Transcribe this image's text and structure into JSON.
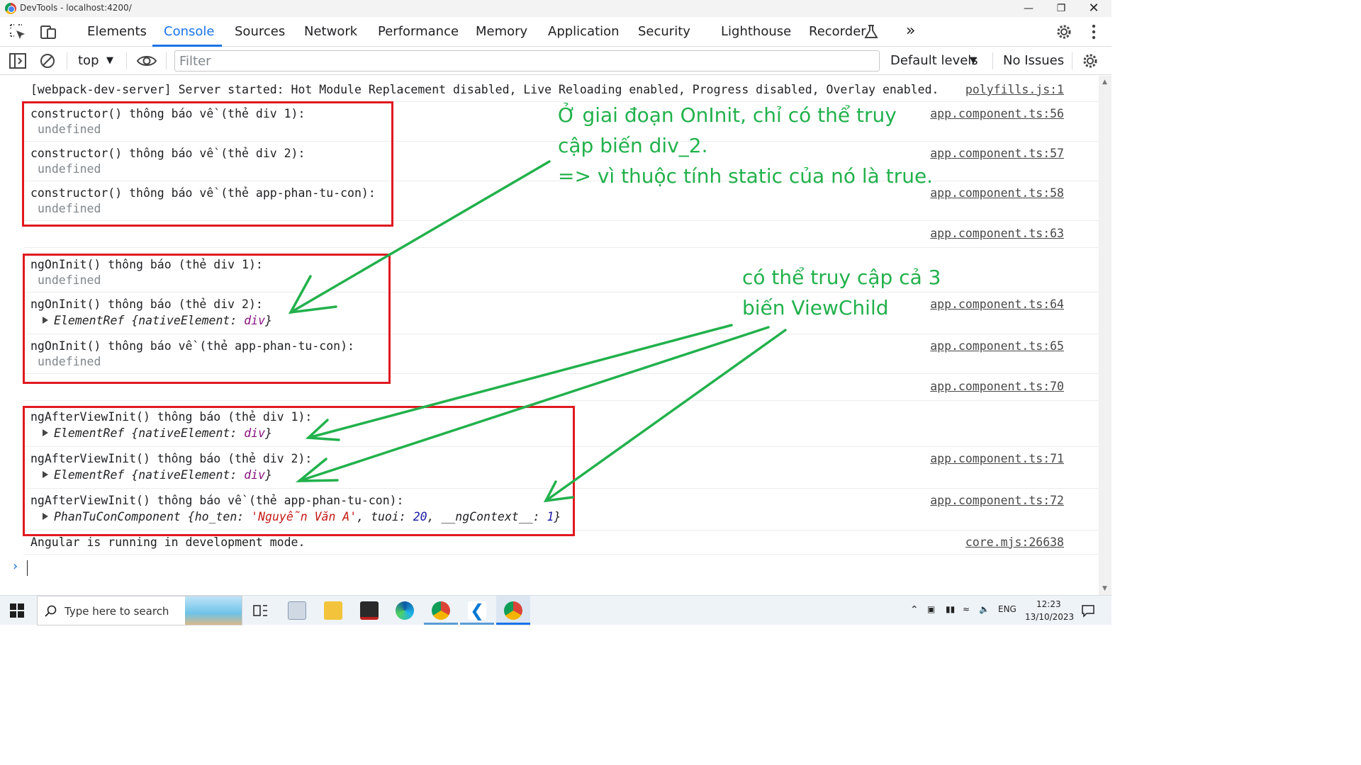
{
  "window": {
    "title": "DevTools - localhost:4200/"
  },
  "tabs": [
    "Elements",
    "Console",
    "Sources",
    "Network",
    "Performance",
    "Memory",
    "Application",
    "Security",
    "Lighthouse",
    "Recorder"
  ],
  "active_tab": "Console",
  "toolbar": {
    "context": "top",
    "filter_placeholder": "Filter",
    "levels": "Default levels",
    "issues": "No Issues"
  },
  "console": {
    "server_msg": "[webpack-dev-server] Server started: Hot Module Replacement disabled, Live Reloading enabled, Progress disabled, Overlay enabled.",
    "server_src": "polyfills.js:1",
    "constructor": [
      {
        "msg": "constructor() thông báo về (thẻ div 1):",
        "val": "undefined",
        "src": "app.component.ts:56"
      },
      {
        "msg": "constructor() thông báo về (thẻ div 2):",
        "val": "undefined",
        "src": "app.component.ts:57"
      },
      {
        "msg": "constructor() thông báo về (thẻ app-phan-tu-con):",
        "val": "undefined",
        "src": "app.component.ts:58"
      }
    ],
    "empty_src_1": "app.component.ts:63",
    "oninit": [
      {
        "msg": "ngOnInit() thông báo (thẻ div 1):",
        "val": "undefined"
      },
      {
        "msg": "ngOnInit() thông báo (thẻ div 2):",
        "src": "app.component.ts:64"
      },
      {
        "msg": "ngOnInit() thông báo về (thẻ app-phan-tu-con):",
        "val": "undefined",
        "src": "app.component.ts:65"
      }
    ],
    "empty_src_2": "app.component.ts:70",
    "afterview": [
      {
        "msg": "ngAfterViewInit() thông báo (thẻ div 1):"
      },
      {
        "msg": "ngAfterViewInit() thông báo (thẻ div 2):",
        "src": "app.component.ts:71"
      },
      {
        "msg": "ngAfterViewInit() thông báo về (thẻ app-phan-tu-con):",
        "src": "app.component.ts:72"
      }
    ],
    "elementref": {
      "name": "ElementRef",
      "open": " {",
      "key": "nativeElement",
      "colon": ": ",
      "val": "div",
      "close": "}"
    },
    "component": {
      "name": "PhanTuConComponent",
      "k1": "ho_ten",
      "v1": "'Nguyễn Văn A'",
      "k2": "tuoi",
      "v2": "20",
      "k3": "__ngContext__",
      "v3": "1"
    },
    "angular_msg": "Angular is running in development mode.",
    "angular_src": "core.mjs:26638"
  },
  "annotations": {
    "note1_l1": "Ở giai đoạn OnInit, chỉ có thể truy",
    "note1_l2": "cập biến div_2.",
    "note1_l3": "=> vì thuộc tính static của nó là true.",
    "note2_l1": "có thể truy cập cả 3",
    "note2_l2": "biến ViewChild",
    "color": "#22b14c",
    "box_color": "#e0191f"
  },
  "taskbar": {
    "search_placeholder": "Type here to search",
    "lang": "ENG",
    "time": "12:23",
    "date": "13/10/2023"
  }
}
